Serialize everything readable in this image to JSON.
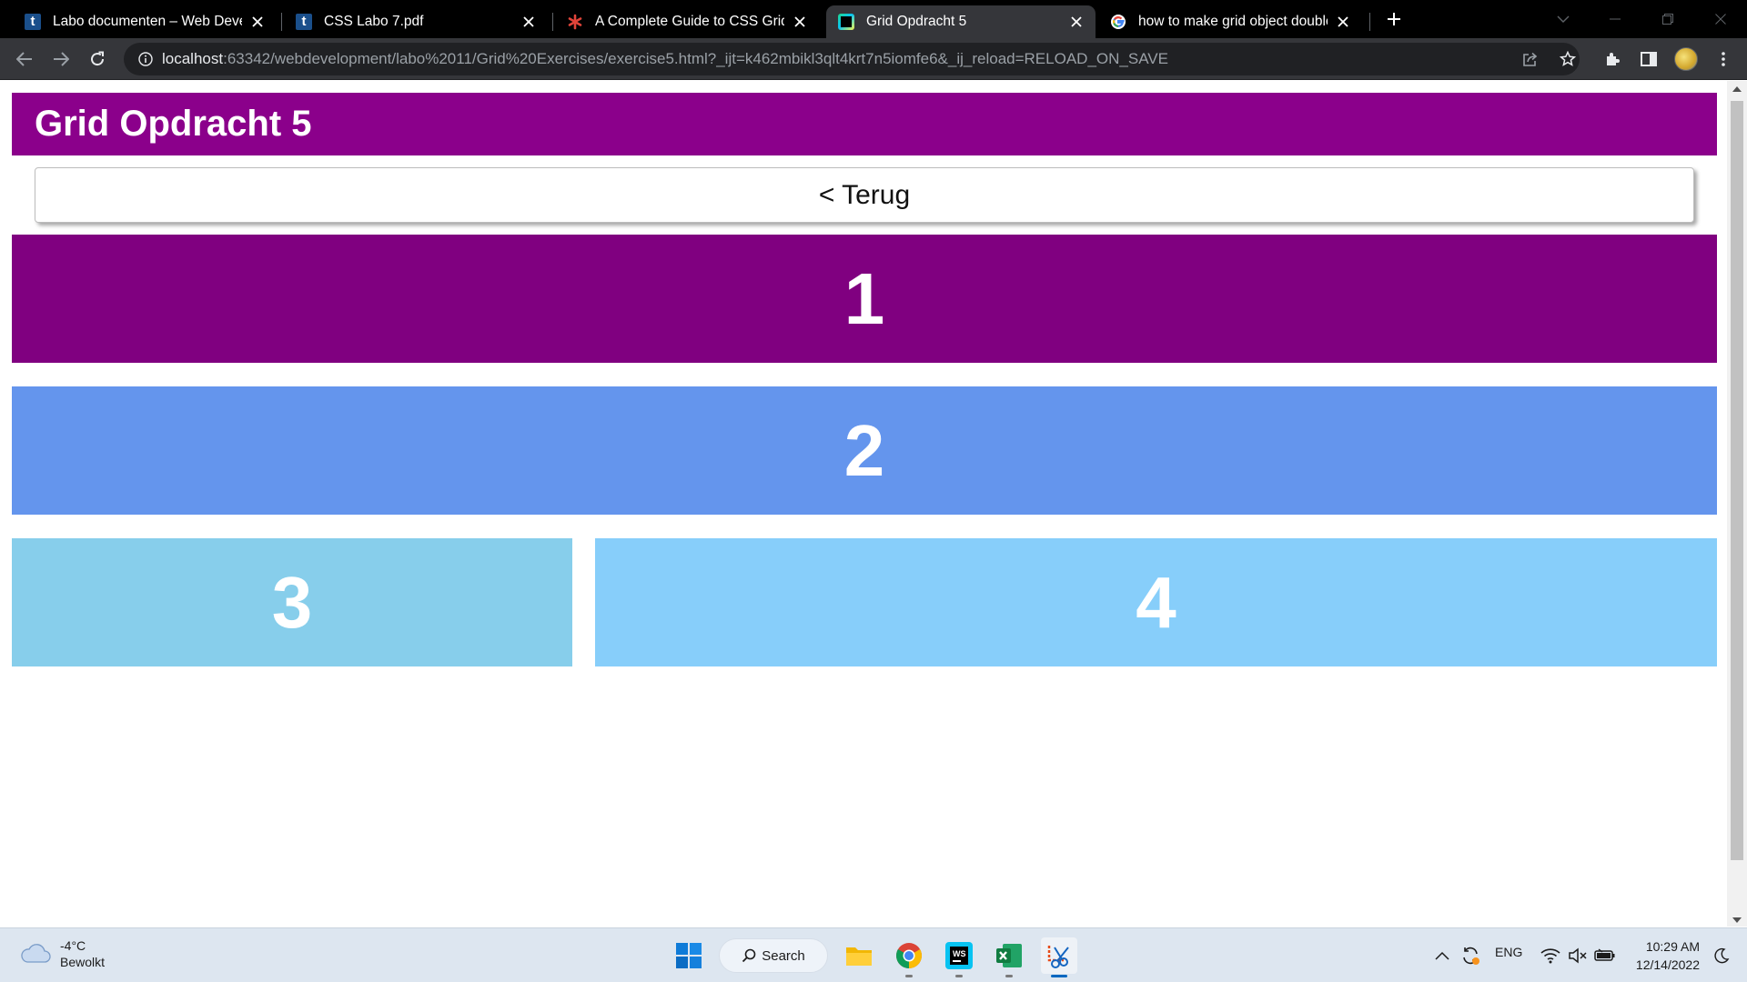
{
  "browser": {
    "tabs": [
      {
        "title": "Labo documenten – Web Develo",
        "favicon": "t-icon",
        "active": false
      },
      {
        "title": "CSS Labo 7.pdf",
        "favicon": "t-icon",
        "active": false
      },
      {
        "title": "A Complete Guide to CSS Grid | C",
        "favicon": "asterisk-icon",
        "active": false
      },
      {
        "title": "Grid Opdracht 5",
        "favicon": "webstorm-icon",
        "active": true
      },
      {
        "title": "how to make grid object double",
        "favicon": "google-icon",
        "active": false
      }
    ],
    "url_host": "localhost",
    "url_rest": ":63342/webdevelopment/labo%2011/Grid%20Exercises/exercise5.html?_ijt=k462mbikl3qlt4krt7n5iomfe6&_ij_reload=RELOAD_ON_SAVE"
  },
  "page": {
    "title": "Grid Opdracht 5",
    "back_label": "< Terug",
    "header_color": "#8b008b",
    "boxes": [
      {
        "label": "1",
        "color": "#800080"
      },
      {
        "label": "2",
        "color": "#6495ed"
      },
      {
        "label": "3",
        "color": "#87ceeb"
      },
      {
        "label": "4",
        "color": "#87cefa"
      }
    ]
  },
  "taskbar": {
    "weather_temp": "-4°C",
    "weather_desc": "Bewolkt",
    "search_label": "Search",
    "language": "ENG",
    "time": "10:29 AM",
    "date": "12/14/2022"
  }
}
